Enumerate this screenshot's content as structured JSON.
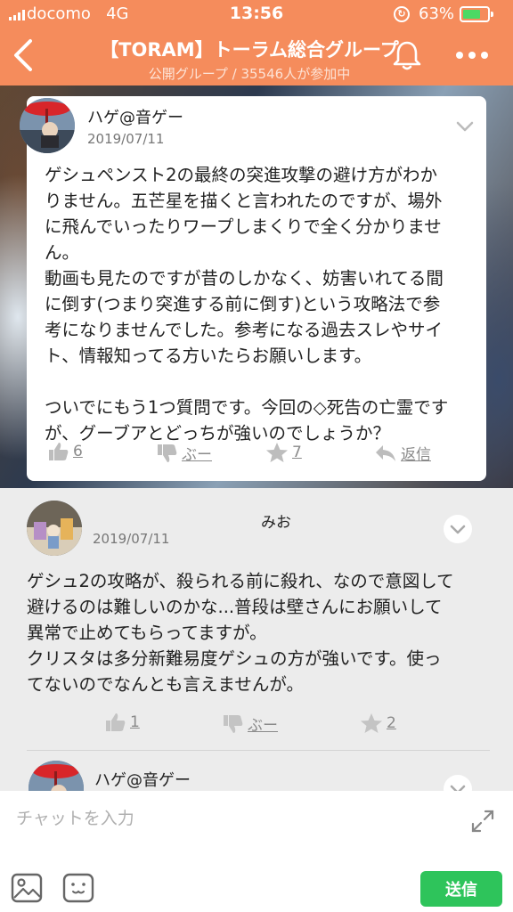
{
  "status": {
    "carrier": "docomo",
    "network": "4G",
    "time": "13:56",
    "battery": "63%"
  },
  "header": {
    "title": "【TORAM】トーラム総合グループ",
    "subtitle": "公開グループ / 35546人が参加中",
    "accent_color": "#f58c5c"
  },
  "post": {
    "author": "ハゲ@音ゲー",
    "date": "2019/07/11",
    "lines": [
      "ゲシュペンスト2の最終の突進攻撃の避け方がわか",
      "りません。五芒星を描くと言われたのですが、場外",
      "に飛んでいったりワープしまくりで全く分かりませ",
      "ん。",
      "動画も見たのですが昔のしかなく、妨害いれてる間",
      "に倒す(つまり突進する前に倒す)という攻略法で参",
      "考になりませんでした。参考になる過去スレやサイ",
      "ト、情報知ってる方いたらお願いします。",
      "",
      "ついでにもう1つ質問です。今回の◇死告の亡霊です",
      "が、グーブアとどっちが強いのでしょうか？"
    ],
    "like_count": "6",
    "dislike_label": "ぶー",
    "star_count": "7",
    "reply_label": "返信"
  },
  "comment": {
    "author": "みお",
    "date": "2019/07/11",
    "lines": [
      "ゲシュ2の攻略が、殺られる前に殺れ、なので意図して",
      "避けるのは難しいのかな...普段は壁さんにお願いして",
      "異常で止めてもらってますが。",
      "クリスタは多分新難易度ゲシュの方が強いです。使っ",
      "てないのでなんとも言えませんが。"
    ],
    "like_count": "1",
    "dislike_label": "ぶー",
    "star_count": "2"
  },
  "comment2": {
    "author": "ハゲ@音ゲー"
  },
  "input": {
    "placeholder": "チャットを入力",
    "send_label": "送信"
  },
  "icons": [
    "back-arrow-icon",
    "bell-icon",
    "more-icon",
    "chevron-down-icon",
    "thumbs-up-icon",
    "thumbs-down-icon",
    "star-icon",
    "reply-icon",
    "expand-icon",
    "image-icon",
    "stamp-icon"
  ]
}
